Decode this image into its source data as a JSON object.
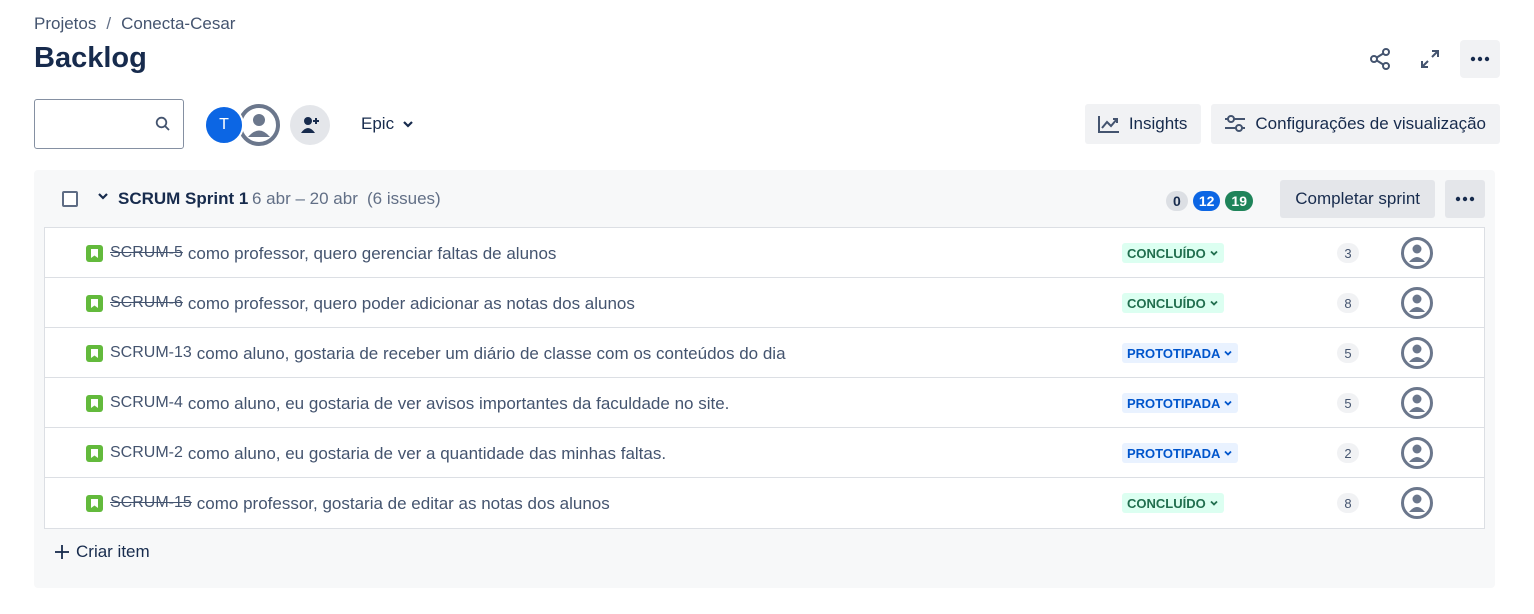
{
  "breadcrumb": {
    "root": "Projetos",
    "separator": "/",
    "project": "Conecta-Cesar"
  },
  "page": {
    "title": "Backlog"
  },
  "top_actions": {
    "share_icon": "share-icon",
    "fullscreen_icon": "expand-icon",
    "more_icon": "more-icon"
  },
  "toolbar": {
    "search_placeholder": "",
    "avatar_initial": "T",
    "epic_label": "Epic",
    "insights_label": "Insights",
    "view_settings_label": "Configurações de visualização"
  },
  "sprint": {
    "name": "SCRUM Sprint 1",
    "dates": "6 abr – 20 abr",
    "issue_count": "(6 issues)",
    "counts": {
      "todo": "0",
      "in_progress": "12",
      "done": "19"
    },
    "complete_label": "Completar sprint"
  },
  "issues": [
    {
      "key": "SCRUM-5",
      "summary": "como professor, quero gerenciar faltas de alunos",
      "status": "CONCLUÍDO",
      "points": "3",
      "done": true
    },
    {
      "key": "SCRUM-6",
      "summary": "como professor, quero poder adicionar as notas dos alunos",
      "status": "CONCLUÍDO",
      "points": "8",
      "done": true
    },
    {
      "key": "SCRUM-13",
      "summary": "como aluno, gostaria de receber um diário de classe com os conteúdos do dia",
      "status": "PROTOTIPADA",
      "points": "5",
      "done": false
    },
    {
      "key": "SCRUM-4",
      "summary": "como aluno, eu gostaria de ver avisos importantes da faculdade no site.",
      "status": "PROTOTIPADA",
      "points": "5",
      "done": false
    },
    {
      "key": "SCRUM-2",
      "summary": "como aluno, eu gostaria de ver a quantidade das minhas faltas.",
      "status": "PROTOTIPADA",
      "points": "2",
      "done": false
    },
    {
      "key": "SCRUM-15",
      "summary": "como professor, gostaria de editar as notas dos alunos",
      "status": "CONCLUÍDO",
      "points": "8",
      "done": true
    }
  ],
  "create_item_label": "Criar item",
  "colors": {
    "done_status_bg": "#dcfff1",
    "done_status_fg": "#216e4e",
    "proto_status_bg": "#e9f2ff",
    "proto_status_fg": "#0055cc",
    "story_icon": "#63ba3c",
    "accent": "#0c66e4"
  }
}
